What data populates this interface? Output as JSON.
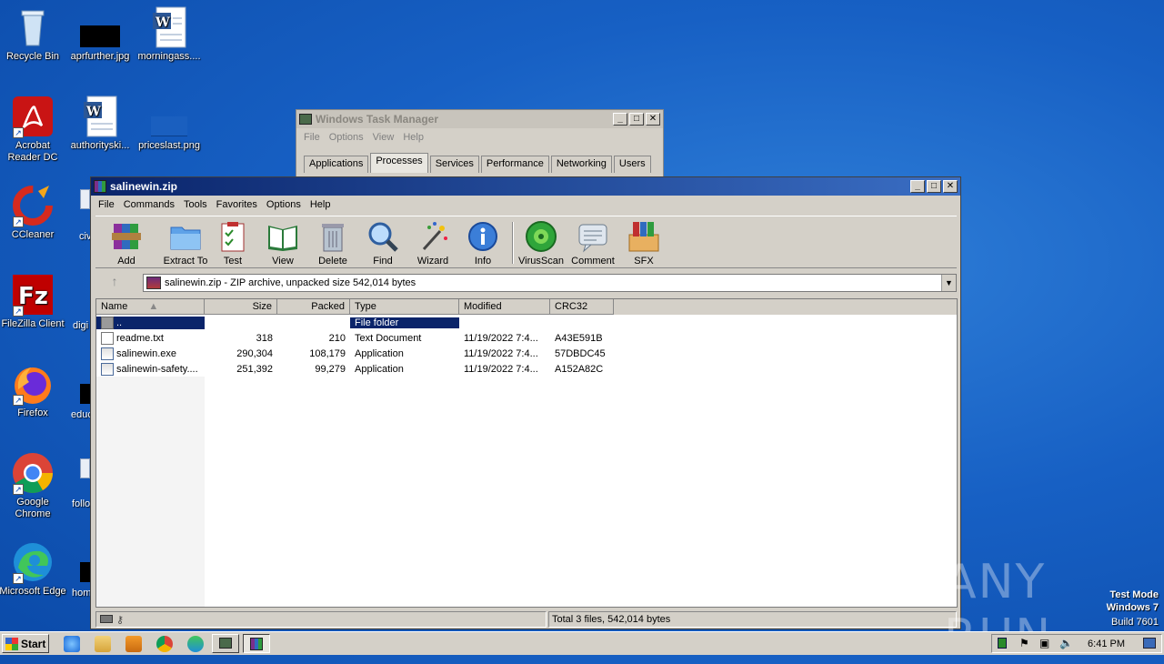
{
  "desktop": {
    "icons": [
      {
        "label": "Recycle Bin"
      },
      {
        "label": "aprfurther.jpg"
      },
      {
        "label": "morningass...."
      },
      {
        "label": "Acrobat Reader DC"
      },
      {
        "label": "authorityski..."
      },
      {
        "label": "priceslast.png"
      },
      {
        "label": "CCleaner"
      },
      {
        "label": "FileZilla Client"
      },
      {
        "label": "Firefox"
      },
      {
        "label": "Google Chrome"
      },
      {
        "label": "Microsoft Edge"
      }
    ],
    "partial_labels": [
      "civ",
      "digi",
      "educ",
      "follo",
      "hom"
    ]
  },
  "task_manager": {
    "title": "Windows Task Manager",
    "menu": [
      "File",
      "Options",
      "View",
      "Help"
    ],
    "tabs": [
      "Applications",
      "Processes",
      "Services",
      "Performance",
      "Networking",
      "Users"
    ],
    "active_tab": "Processes"
  },
  "winrar": {
    "title": "salinewin.zip",
    "menu": [
      "File",
      "Commands",
      "Tools",
      "Favorites",
      "Options",
      "Help"
    ],
    "toolbar": [
      {
        "label": "Add",
        "icon": "add-icon"
      },
      {
        "label": "Extract To",
        "icon": "extract-icon"
      },
      {
        "label": "Test",
        "icon": "test-icon"
      },
      {
        "label": "View",
        "icon": "view-icon"
      },
      {
        "label": "Delete",
        "icon": "delete-icon"
      },
      {
        "label": "Find",
        "icon": "find-icon"
      },
      {
        "label": "Wizard",
        "icon": "wizard-icon"
      },
      {
        "label": "Info",
        "icon": "info-icon"
      },
      {
        "label": "VirusScan",
        "icon": "virusscan-icon"
      },
      {
        "label": "Comment",
        "icon": "comment-icon"
      },
      {
        "label": "SFX",
        "icon": "sfx-icon"
      }
    ],
    "address": "salinewin.zip - ZIP archive, unpacked size 542,014 bytes",
    "columns": [
      "Name",
      "Size",
      "Packed",
      "Type",
      "Modified",
      "CRC32"
    ],
    "rows": [
      {
        "name": "..",
        "size": "",
        "packed": "",
        "type": "File folder",
        "modified": "",
        "crc": "",
        "icon": "folder"
      },
      {
        "name": "readme.txt",
        "size": "318",
        "packed": "210",
        "type": "Text Document",
        "modified": "11/19/2022 7:4...",
        "crc": "A43E591B",
        "icon": "txt"
      },
      {
        "name": "salinewin.exe",
        "size": "290,304",
        "packed": "108,179",
        "type": "Application",
        "modified": "11/19/2022 7:4...",
        "crc": "57DBDC45",
        "icon": "exe"
      },
      {
        "name": "salinewin-safety....",
        "size": "251,392",
        "packed": "99,279",
        "type": "Application",
        "modified": "11/19/2022 7:4...",
        "crc": "A152A82C",
        "icon": "exe"
      }
    ],
    "status": "Total 3 files, 542,014 bytes"
  },
  "taskbar": {
    "start_label": "Start",
    "clock": "6:41 PM"
  },
  "watermark": {
    "line1": "Test Mode",
    "line2": "Windows 7",
    "line3": "Build 7601",
    "brand": "ANY RUN"
  },
  "colors": {
    "desktop": "#1760c4",
    "titlebar_active": "#0a246a",
    "selection": "#0a246a",
    "window_face": "#d4d0c8"
  }
}
